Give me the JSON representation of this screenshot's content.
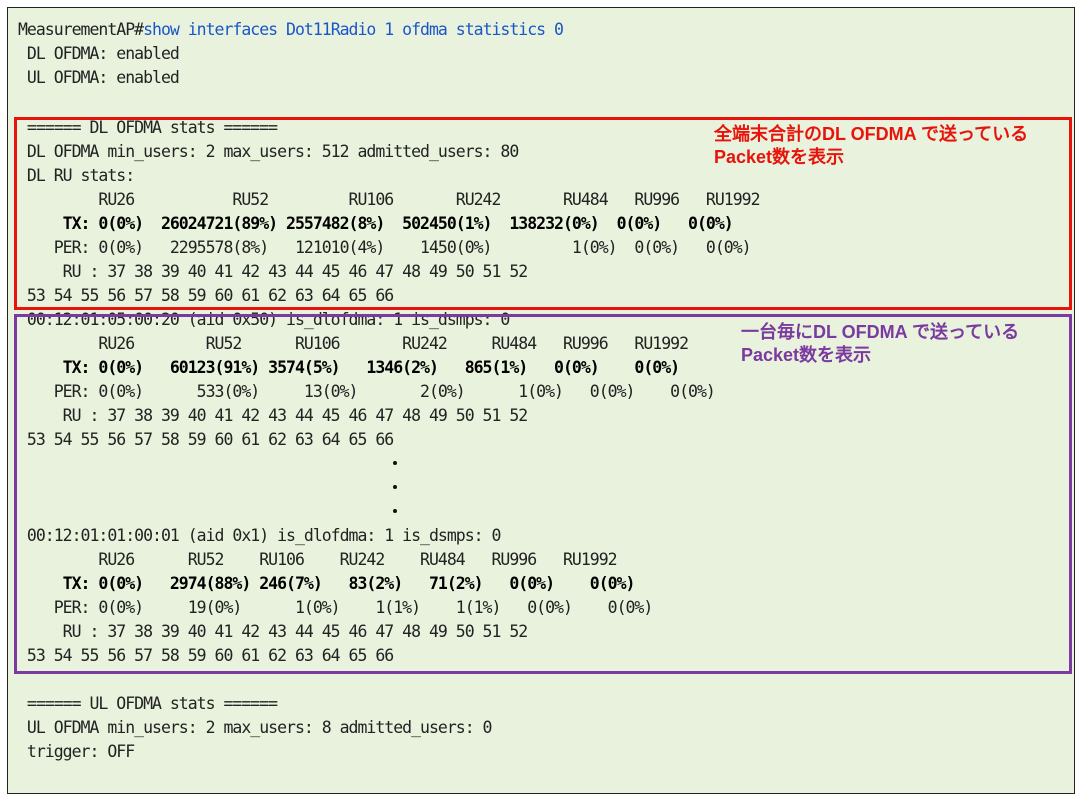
{
  "prompt": "MeasurementAP#",
  "command": "show interfaces Dot11Radio 1 ofdma statistics 0",
  "header_lines": [
    " DL OFDMA: enabled",
    " UL OFDMA: enabled"
  ],
  "dl": {
    "title": " ====== DL OFDMA stats ======",
    "users": " DL OFDMA min_users: 2 max_users: 512 admitted_users: 80",
    "ru_title": " DL RU stats:",
    "cols": "         RU26           RU52         RU106       RU242       RU484   RU996   RU1992",
    "tx": "     TX: 0(0%)  26024721(89%) 2557482(8%)  502450(1%)  138232(0%)  0(0%)   0(0%)",
    "per": "    PER: 0(0%)   2295578(8%)   121010(4%)    1450(0%)         1(0%)  0(0%)   0(0%)",
    "ru": "     RU : 37 38 39 40 41 42 43 44 45 46 47 48 49 50 51 52",
    "ru2": " 53 54 55 56 57 58 59 60 61 62 63 64 65 66"
  },
  "client1": {
    "head": " 00:12:01:05:00:20 (aid 0x50) is_dlofdma: 1 is_dsmps: 0",
    "cols": "         RU26        RU52      RU106       RU242     RU484   RU996   RU1992",
    "tx": "     TX: 0(0%)   60123(91%) 3574(5%)   1346(2%)   865(1%)   0(0%)    0(0%)",
    "per": "    PER: 0(0%)      533(0%)     13(0%)       2(0%)      1(0%)   0(0%)    0(0%)",
    "ru": "     RU : 37 38 39 40 41 42 43 44 45 46 47 48 49 50 51 52",
    "ru2": " 53 54 55 56 57 58 59 60 61 62 63 64 65 66"
  },
  "client2": {
    "head": " 00:12:01:01:00:01 (aid 0x1) is_dlofdma: 1 is_dsmps: 0",
    "cols": "         RU26      RU52    RU106    RU242    RU484   RU996   RU1992",
    "tx": "     TX: 0(0%)   2974(88%) 246(7%)   83(2%)   71(2%)   0(0%)    0(0%)",
    "per": "    PER: 0(0%)     19(0%)      1(0%)    1(1%)    1(1%)   0(0%)    0(0%)",
    "ru": "     RU : 37 38 39 40 41 42 43 44 45 46 47 48 49 50 51 52",
    "ru2": " 53 54 55 56 57 58 59 60 61 62 63 64 65 66"
  },
  "ul": {
    "title": " ====== UL OFDMA stats ======",
    "users": " UL OFDMA min_users: 2 max_users: 8 admitted_users: 0",
    "trigger": " trigger: OFF"
  },
  "annotations": {
    "red_line1": "全端末合計のDL OFDMA で送っている",
    "red_line2": "Packet数を表示",
    "purple_line1": "一台毎にDL OFDMA で送っている",
    "purple_line2": "Packet数を表示"
  },
  "colors": {
    "command": "#1a56c8",
    "red_box": "#e8140c",
    "purple_box": "#7a3aa0",
    "background": "#e8f2dc"
  }
}
